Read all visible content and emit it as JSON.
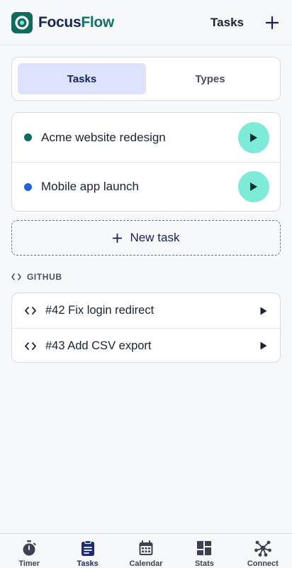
{
  "app": {
    "brand_part1": "Focus",
    "brand_part2": "Flow"
  },
  "header": {
    "title": "Tasks"
  },
  "segments": {
    "tasks": "Tasks",
    "types": "Types"
  },
  "tasks": [
    {
      "name": "Acme website redesign",
      "color": "#0f6a5f"
    },
    {
      "name": "Mobile app launch",
      "color": "#1f67d0"
    }
  ],
  "new_task": {
    "label": "New task"
  },
  "github": {
    "section_label": "GITHUB",
    "issues": [
      {
        "title": "#42 Fix login redirect"
      },
      {
        "title": "#43 Add CSV export"
      }
    ]
  },
  "nav": [
    {
      "label": "Timer",
      "icon": "stopwatch-icon"
    },
    {
      "label": "Tasks",
      "icon": "clipboard-icon",
      "active": true
    },
    {
      "label": "Calendar",
      "icon": "calendar-icon"
    },
    {
      "label": "Stats",
      "icon": "dashboard-icon"
    },
    {
      "label": "Connect",
      "icon": "network-icon"
    }
  ],
  "colors": {
    "accent": "#152158",
    "brand_green": "#10736a",
    "play_bg": "#7eead8",
    "active_segment": "#dde3fd"
  }
}
